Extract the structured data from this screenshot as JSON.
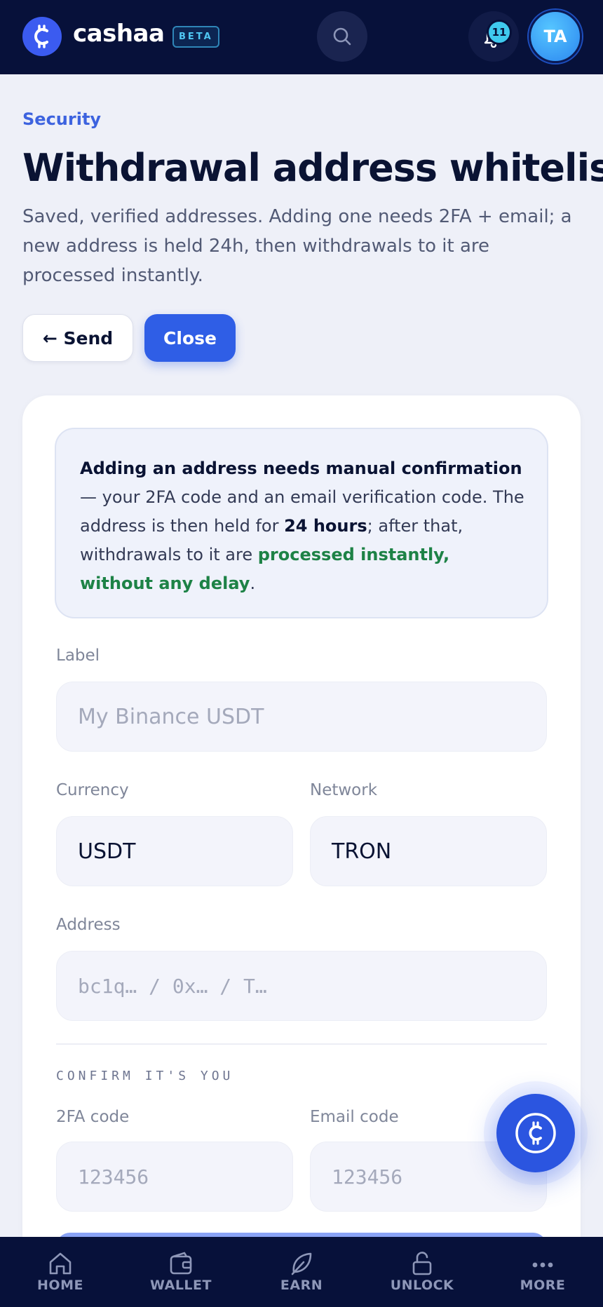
{
  "header": {
    "logo_text": "cashaa",
    "beta_label": "BETA",
    "notification_count": "11",
    "avatar_initials": "TA"
  },
  "page": {
    "eyebrow": "Security",
    "title": "Withdrawal address whitelist",
    "description": "Saved, verified addresses. Adding one needs 2FA + email; a new address is held 24h, then withdrawals to it are processed instantly.",
    "send_button": "← Send",
    "close_button": "Close"
  },
  "notice": {
    "bold_lead": "Adding an address needs manual confirmation",
    "text_1": " — your 2FA code and an email verification code. The address is then held for ",
    "hold_period": "24 hours",
    "text_2": "; after that, withdrawals to it are ",
    "green_text": "processed instantly, without any delay",
    "text_3": "."
  },
  "form": {
    "label_label": "Label",
    "label_placeholder": "My Binance USDT",
    "currency_label": "Currency",
    "currency_value": "USDT",
    "network_label": "Network",
    "network_value": "TRON",
    "address_label": "Address",
    "address_placeholder": "bc1q… / 0x… / T…",
    "confirm_caption": "CONFIRM IT'S YOU",
    "twofa_label": "2FA code",
    "twofa_placeholder": "123456",
    "email_label": "Email code",
    "email_placeholder": "123456"
  },
  "bottom_nav": {
    "home": "HOME",
    "wallet": "WALLET",
    "earn": "EARN",
    "unlock": "UNLOCK",
    "more": "MORE"
  },
  "colors": {
    "header_bg": "#07113a",
    "accent": "#2f5ee6",
    "success": "#1d8246"
  }
}
